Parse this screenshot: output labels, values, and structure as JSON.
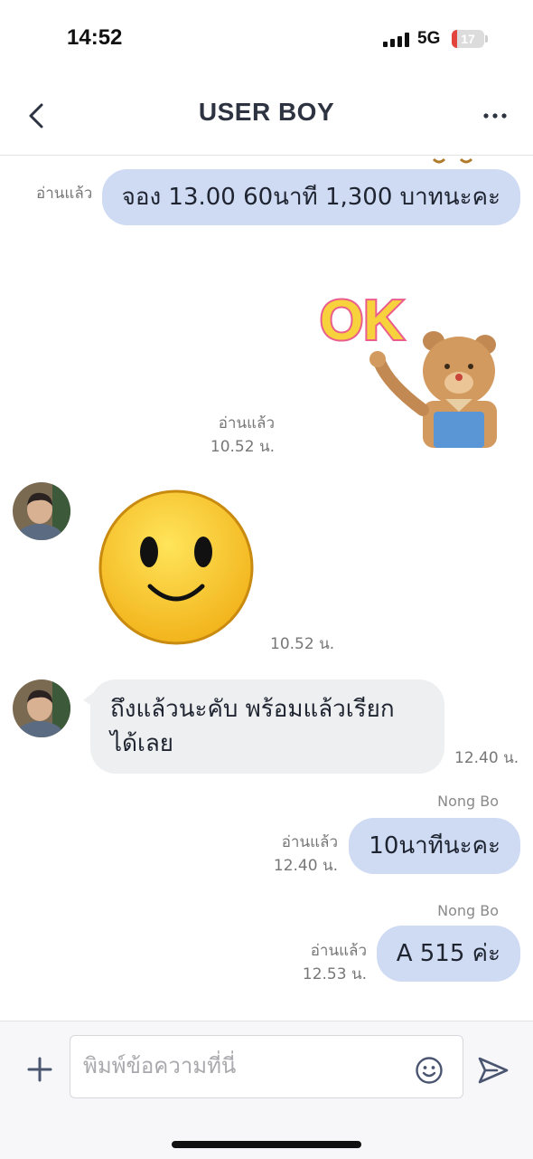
{
  "status_bar": {
    "time": "14:52",
    "network": "5G",
    "battery": "17",
    "battery_level": 0.17,
    "signal_icon": "signal-bars-icon"
  },
  "header": {
    "title": "USER BOY",
    "back_icon": "chevron-left-icon",
    "more_icon": "more-horizontal-icon"
  },
  "messages": {
    "m1": {
      "read": "อ่านแล้ว",
      "text": "จอง 13.00 60นาที 1,300 บาทนะคะ"
    },
    "m2": {
      "read": "อ่านแล้ว",
      "time": "10.52 น.",
      "sticker": "ok-bear-sticker"
    },
    "m3": {
      "time": "10.52 น.",
      "sticker": "smiley-face-sticker"
    },
    "m4": {
      "text_line1": "ถึงแล้วนะคับ พร้อมแล้วเรียก",
      "text_line2": "ได้เลย",
      "time": "12.40 น."
    },
    "m5": {
      "sender": "Nong Bo",
      "read": "อ่านแล้ว",
      "time": "12.40 น.",
      "text": "10นาทีนะคะ"
    },
    "m6": {
      "sender": "Nong Bo",
      "read": "อ่านแล้ว",
      "time": "12.53 น.",
      "text": "A 515 ค่ะ"
    }
  },
  "sticker_text": {
    "ok": "OK"
  },
  "input": {
    "placeholder": "พิมพ์ข้อความที่นี่",
    "value": ""
  },
  "colors": {
    "outgoing_bubble": "#cfdaf3",
    "incoming_bubble": "#eeeff1",
    "title": "#2e3342",
    "send_icon": "#4a5570"
  }
}
